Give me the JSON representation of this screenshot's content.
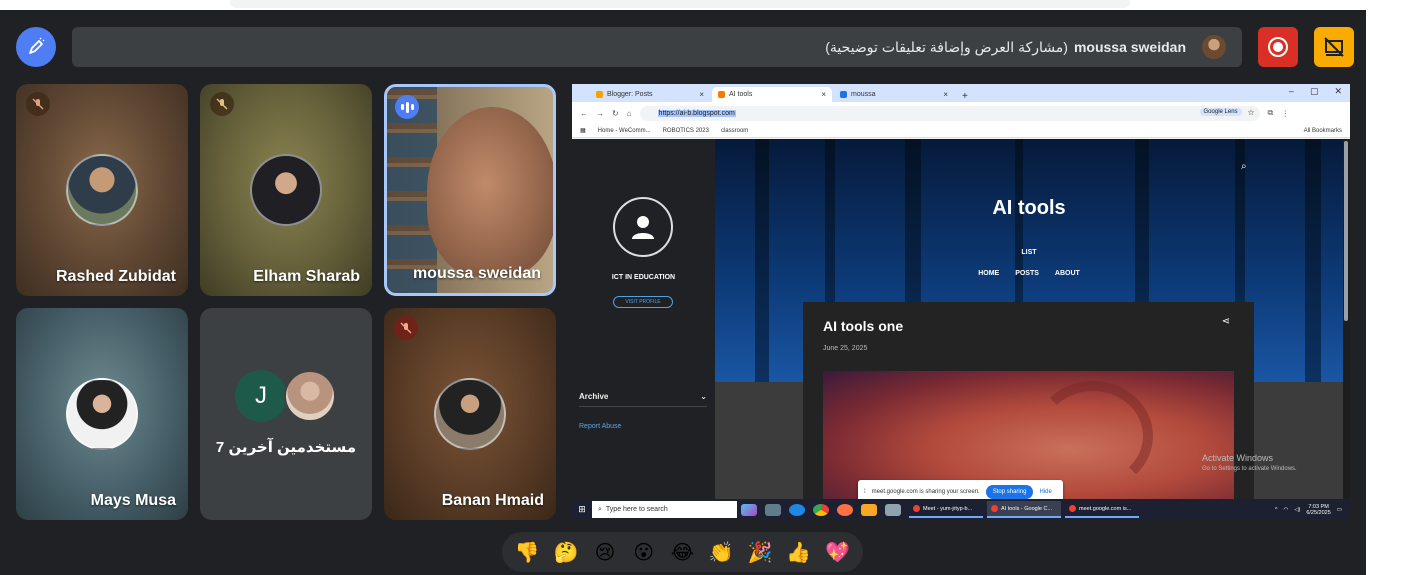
{
  "header": {
    "presenter_name": "moussa sweidan",
    "presenter_status": "(مشاركة العرض وإضافة تعليقات توضيحية)"
  },
  "tiles": [
    {
      "name": "Rashed Zubidat",
      "muted": true
    },
    {
      "name": "Elham Sharab",
      "muted": true
    },
    {
      "name": "moussa sweidan",
      "speaking": true
    },
    {
      "name": "Mays Musa",
      "muted": false
    },
    {
      "others_initial": "J",
      "others_label": "7 مستخدمين آخرين"
    },
    {
      "name": "Banan Hmaid",
      "muted": true
    }
  ],
  "browser": {
    "tabs": [
      {
        "label": "Blogger: Posts",
        "active": false,
        "color": "#f4a300"
      },
      {
        "label": "AI tools",
        "active": true,
        "color": "#f57c00"
      },
      {
        "label": "moussa",
        "active": false,
        "color": "#1a73e8"
      }
    ],
    "url_prefix": "https://",
    "url_host": "ai-b.blogspot.com",
    "lens_label": "Google Lens",
    "bookmarks": [
      "Home - WeComm...",
      "ROBOTICS 2023",
      "classroom"
    ],
    "all_bookmarks": "All Bookmarks"
  },
  "blog": {
    "sidebar_title": "ICT IN EDUCATION",
    "visit_profile": "VISIT PROFILE",
    "archive": "Archive",
    "report_abuse": "Report Abuse",
    "title": "AI tools",
    "list_label": "LIST",
    "nav": [
      "HOME",
      "POSTS",
      "ABOUT"
    ],
    "post_title": "AI tools one",
    "post_date": "June 25, 2025"
  },
  "share_notice": {
    "text": "meet.google.com is sharing your screen.",
    "stop": "Stop sharing",
    "hide": "Hide"
  },
  "activate": {
    "title": "Activate Windows",
    "sub": "Go to Settings to activate Windows."
  },
  "taskbar": {
    "search_placeholder": "Type here to search",
    "apps": [
      "Meet - yum-jrtyp-b...",
      "AI tools - Google C...",
      "meet.google.com is..."
    ],
    "time": "7:03 PM",
    "date": "6/25/2025"
  },
  "reactions": [
    "👎",
    "🤔",
    "😢",
    "😮",
    "😂",
    "👏",
    "🎉",
    "👍",
    "💖"
  ],
  "colors": {
    "pen_button": "#4f7df3",
    "record_button": "#d93025",
    "present_button": "#f9ab00",
    "speaking_border": "#a8c7fa"
  }
}
